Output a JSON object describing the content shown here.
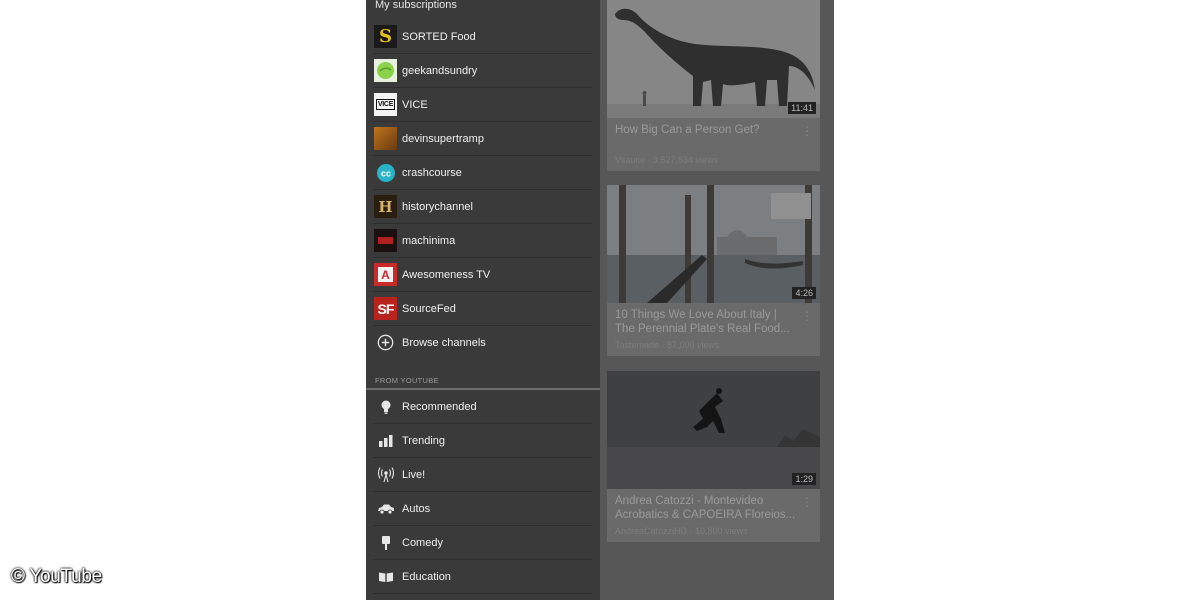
{
  "drawer": {
    "header": "My subscriptions",
    "subscriptions": [
      {
        "label": "SORTED Food",
        "icon": "sorted-food-avatar"
      },
      {
        "label": "geekandsundry",
        "icon": "geekandsundry-avatar"
      },
      {
        "label": "VICE",
        "icon": "vice-avatar"
      },
      {
        "label": "devinsupertramp",
        "icon": "devinsupertramp-avatar"
      },
      {
        "label": "crashcourse",
        "icon": "crashcourse-avatar"
      },
      {
        "label": "historychannel",
        "icon": "historychannel-avatar"
      },
      {
        "label": "machinima",
        "icon": "machinima-avatar"
      },
      {
        "label": "Awesomeness TV",
        "icon": "awesomeness-tv-avatar"
      },
      {
        "label": "SourceFed",
        "icon": "sourcefed-avatar"
      }
    ],
    "browse_channels": "Browse channels",
    "from_youtube_label": "FROM YOUTUBE",
    "categories": [
      {
        "label": "Recommended",
        "icon": "lightbulb-icon"
      },
      {
        "label": "Trending",
        "icon": "bar-chart-icon"
      },
      {
        "label": "Live!",
        "icon": "broadcast-icon"
      },
      {
        "label": "Autos",
        "icon": "car-icon"
      },
      {
        "label": "Comedy",
        "icon": "microphone-icon"
      },
      {
        "label": "Education",
        "icon": "book-icon"
      }
    ]
  },
  "feed": {
    "videos": [
      {
        "title_line1": "How Big Can a Person Get?",
        "title_line2": "",
        "meta": "Vsauce · 3,527,834 views",
        "duration": "11:41"
      },
      {
        "title_line1": "10 Things We Love About Italy |",
        "title_line2": "The Perennial Plate's Real Food...",
        "meta": "Tastemade · 87,000 views",
        "duration": "4:26"
      },
      {
        "title_line1": "Andrea Catozzi - Montevideo",
        "title_line2": "Acrobatics & CAPOEIRA Floreios...",
        "meta": "AndreaCatozziHD · 10,800 views",
        "duration": "1:29"
      }
    ]
  },
  "watermark": "© YouTube",
  "colors": {
    "drawer_bg": "#3a3a3a",
    "feed_bg": "#575757",
    "sorted_yellow": "#e6c21a",
    "geek_green": "#8bd14a",
    "crashcourse_teal": "#2ab3c6",
    "history_brown": "#6b4a22",
    "awesomeness_red": "#c92a2a",
    "sourcefed_red": "#b8231d"
  }
}
